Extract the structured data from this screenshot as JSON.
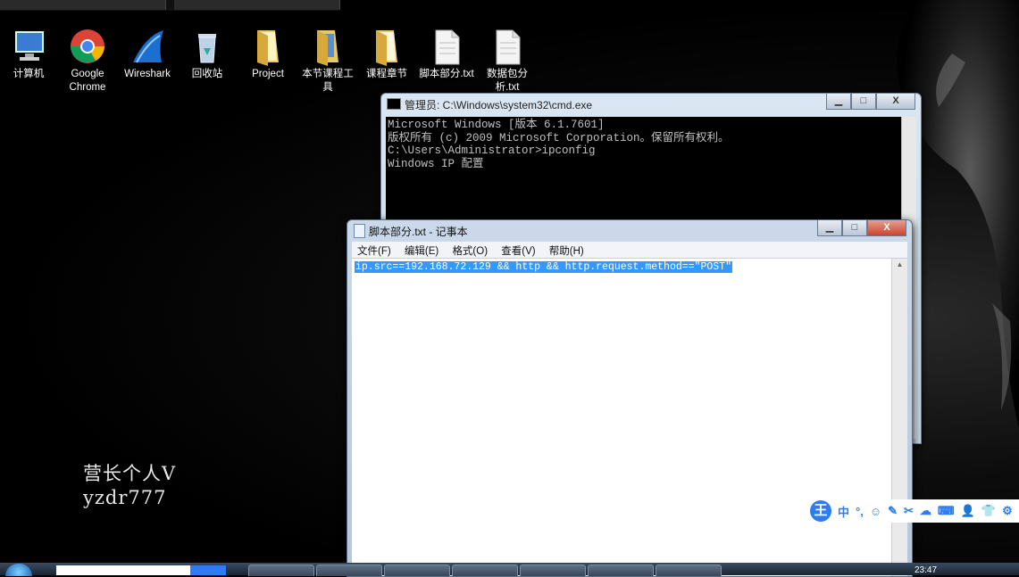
{
  "desktop_icons": [
    {
      "label": "计算机",
      "icon": "computer-icon"
    },
    {
      "label": "Google Chrome",
      "icon": "chrome-icon"
    },
    {
      "label": "Wireshark",
      "icon": "wireshark-icon"
    },
    {
      "label": "回收站",
      "icon": "recycle-bin-icon"
    },
    {
      "label": "Project",
      "icon": "folder-icon"
    },
    {
      "label": "本节课程工具",
      "icon": "folder-icon"
    },
    {
      "label": "课程章节",
      "icon": "folder-icon"
    },
    {
      "label": "脚本部分.txt",
      "icon": "text-file-icon"
    },
    {
      "label": "数据包分析.txt",
      "icon": "text-file-icon"
    }
  ],
  "watermark": {
    "line1": "营长个人V",
    "line2": "yzdr777"
  },
  "cmd_window": {
    "title": "管理员: C:\\Windows\\system32\\cmd.exe",
    "lines": [
      "Microsoft Windows [版本 6.1.7601]",
      "版权所有 (c) 2009 Microsoft Corporation。保留所有权利。",
      "",
      "C:\\Users\\Administrator>ipconfig",
      "",
      "Windows IP 配置"
    ],
    "buttons": {
      "min": "▁",
      "max": "□",
      "close": "X"
    }
  },
  "notepad_window": {
    "title": "脚本部分.txt - 记事本",
    "menu": [
      "文件(F)",
      "编辑(E)",
      "格式(O)",
      "查看(V)",
      "帮助(H)"
    ],
    "content": "ip.src==192.168.72.129 && http && http.request.method==\"POST\"",
    "buttons": {
      "min": "▁",
      "max": "□",
      "close": "X"
    }
  },
  "ime_toolbar": {
    "logo": "王",
    "mode": "中",
    "items": [
      "°,",
      "☺",
      "✎",
      "✂",
      "☁",
      "⌨",
      "👤",
      "👕",
      "⚙"
    ]
  },
  "taskbar": {
    "clock": "23:47"
  },
  "colors": {
    "selection": "#3399ff",
    "ime_blue": "#2d7df0"
  }
}
